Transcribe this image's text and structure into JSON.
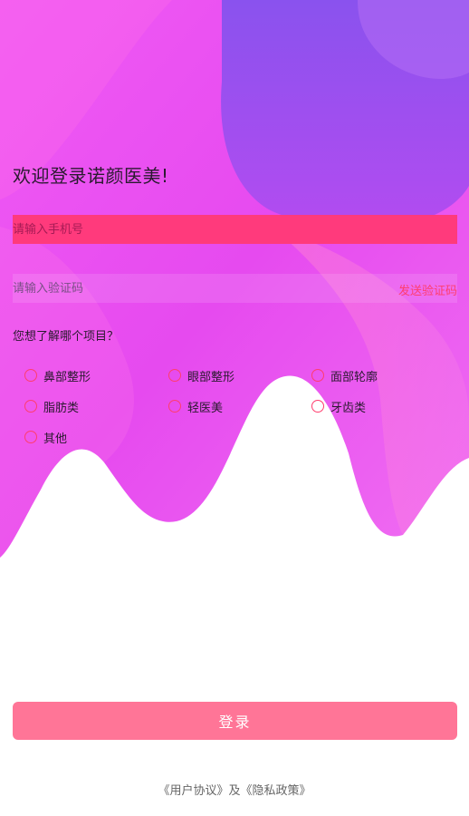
{
  "header": {
    "title": "欢迎登录诺颜医美!"
  },
  "form": {
    "phone": {
      "value": "",
      "placeholder": "请输入手机号"
    },
    "code": {
      "value": "",
      "placeholder": "请输入验证码"
    },
    "send_code_label": "发送验证码"
  },
  "survey": {
    "question": "您想了解哪个项目？",
    "options": [
      {
        "label": "鼻部整形",
        "checked": false
      },
      {
        "label": "眼部整形",
        "checked": false
      },
      {
        "label": "面部轮廓",
        "checked": false
      },
      {
        "label": "脂肪类",
        "checked": false
      },
      {
        "label": "轻医美",
        "checked": false
      },
      {
        "label": "牙齿类",
        "checked": false
      },
      {
        "label": "其他",
        "checked": false
      }
    ]
  },
  "login_label": "登录",
  "footer": {
    "user_agreement": "《用户协议》",
    "conjunction": "及",
    "privacy_policy": "《隐私政策》"
  },
  "colors": {
    "accent": "#ff3d6e",
    "login_button": "#ff7597",
    "background_purple": "#a355f0",
    "background_magenta": "#ee48f2"
  }
}
